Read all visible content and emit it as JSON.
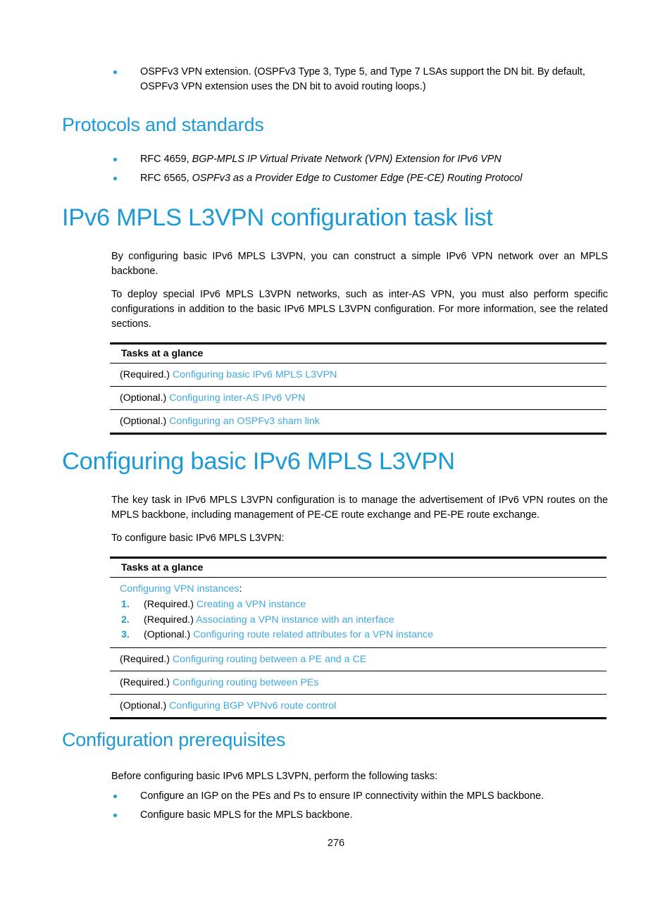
{
  "document": {
    "page_number": "276"
  },
  "intro_bullets": [
    "OSPFv3 VPN extension. (OSPFv3 Type 3, Type 5, and Type 7 LSAs support the DN bit. By default, OSPFv3 VPN extension uses the DN bit to avoid routing loops.)"
  ],
  "protocols_section": {
    "heading": "Protocols and standards",
    "items": [
      {
        "prefix": "RFC 4659, ",
        "italic": "BGP-MPLS IP Virtual Private Network (VPN) Extension for IPv6 VPN"
      },
      {
        "prefix": "RFC 6565, ",
        "italic": "OSPFv3 as a Provider Edge to Customer Edge (PE-CE) Routing Protocol"
      }
    ]
  },
  "task_list_section": {
    "heading": "IPv6 MPLS L3VPN configuration task list",
    "paragraphs": [
      "By configuring basic IPv6 MPLS L3VPN, you can construct a simple IPv6 VPN network over an MPLS backbone.",
      "To deploy special IPv6 MPLS L3VPN networks, such as inter-AS VPN, you must also perform specific configurations in addition to the basic IPv6 MPLS L3VPN configuration. For more information, see the related sections."
    ],
    "table": {
      "header": "Tasks at a glance",
      "rows": [
        {
          "qualifier": "(Required.) ",
          "link": "Configuring basic IPv6 MPLS L3VPN"
        },
        {
          "qualifier": "(Optional.) ",
          "link": "Configuring inter-AS IPv6 VPN"
        },
        {
          "qualifier": "(Optional.) ",
          "link": "Configuring an OSPFv3 sham link"
        }
      ]
    }
  },
  "basic_config_section": {
    "heading": "Configuring basic IPv6 MPLS L3VPN",
    "paragraphs": [
      "The key task in IPv6 MPLS L3VPN configuration is to manage the advertisement of IPv6 VPN routes on the MPLS backbone, including management of PE-CE route exchange and PE-PE route exchange.",
      "To configure basic IPv6 MPLS L3VPN:"
    ],
    "table": {
      "header": "Tasks at a glance",
      "group_row": {
        "link": "Configuring VPN instances",
        "suffix": ":",
        "steps": [
          {
            "num": "1.",
            "qualifier": "(Required.) ",
            "link": "Creating a VPN instance"
          },
          {
            "num": "2.",
            "qualifier": "(Required.) ",
            "link": "Associating a VPN instance with an interface"
          },
          {
            "num": "3.",
            "qualifier": "(Optional.) ",
            "link": "Configuring route related attributes for a VPN instance"
          }
        ]
      },
      "rows": [
        {
          "qualifier": "(Required.) ",
          "link": "Configuring routing between a PE and a CE"
        },
        {
          "qualifier": "(Required.) ",
          "link": "Configuring routing between PEs"
        },
        {
          "qualifier": "(Optional.) ",
          "link": "Configuring BGP VPNv6 route control"
        }
      ]
    }
  },
  "prerequisites_section": {
    "heading": "Configuration prerequisites",
    "intro": "Before configuring basic IPv6 MPLS L3VPN, perform the following tasks:",
    "bullets": [
      "Configure an IGP on the PEs and Ps to ensure IP connectivity within the MPLS backbone.",
      "Configure basic MPLS for the MPLS backbone."
    ]
  },
  "colors": {
    "heading_blue": "#1b9ad6",
    "link_blue": "#40a8dd",
    "bullet_blue": "#1b9ad6",
    "text_black": "#000000"
  }
}
